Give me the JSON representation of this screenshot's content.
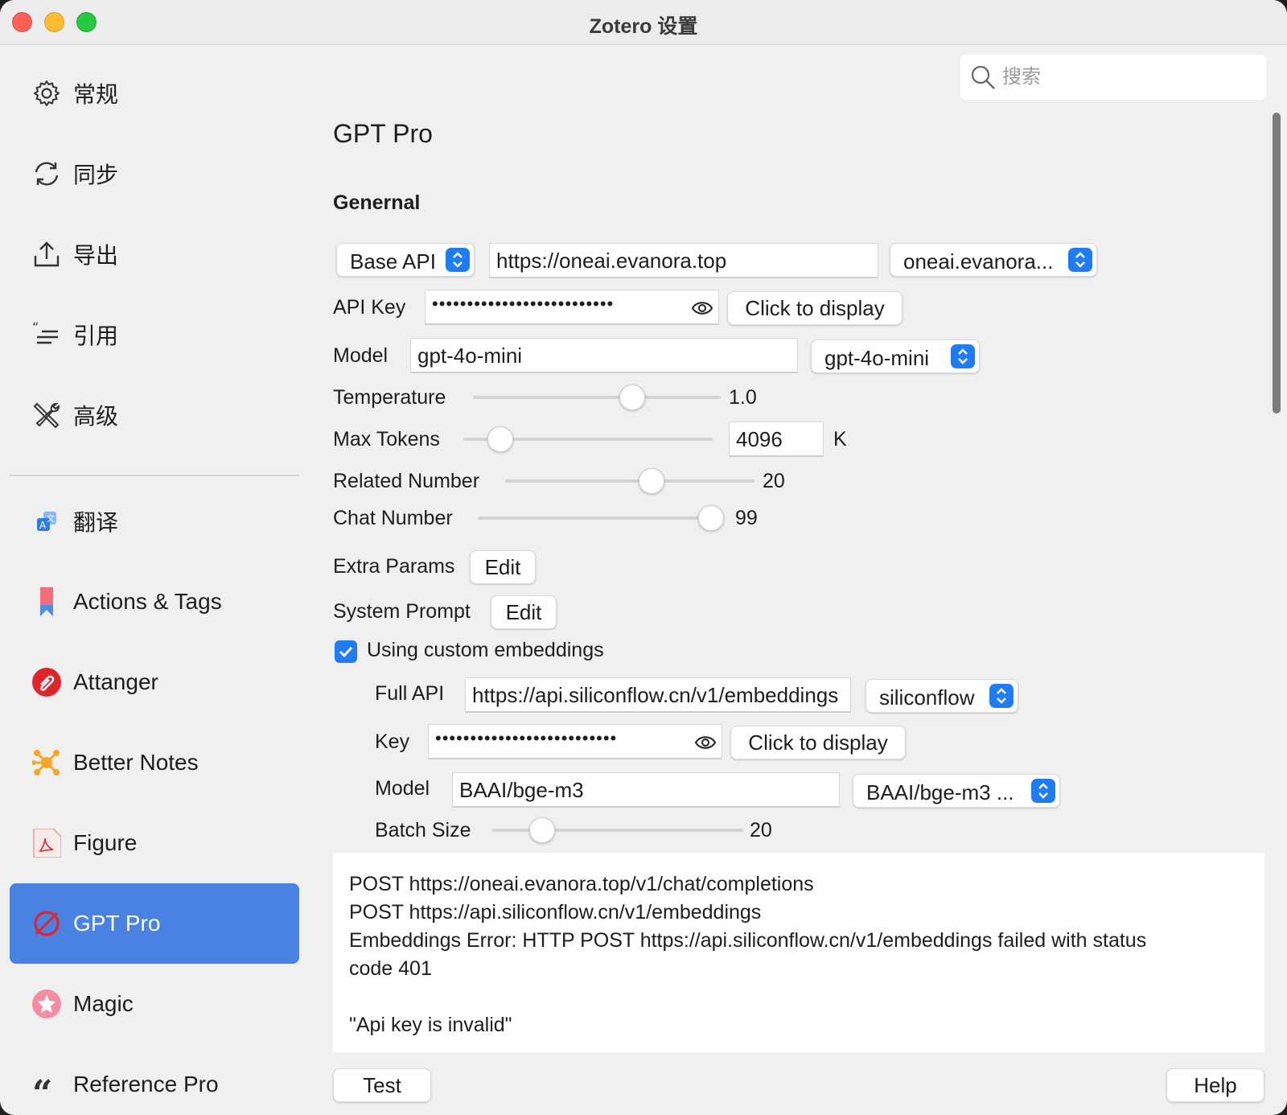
{
  "window": {
    "title": "Zotero 设置"
  },
  "sidebar": {
    "items": [
      {
        "label": "常规",
        "icon": "gear-icon"
      },
      {
        "label": "同步",
        "icon": "sync-icon"
      },
      {
        "label": "导出",
        "icon": "export-icon"
      },
      {
        "label": "引用",
        "icon": "cite-icon"
      },
      {
        "label": "高级",
        "icon": "tools-icon"
      },
      {
        "label": "翻译",
        "icon": "translate-icon"
      },
      {
        "label": "Actions & Tags",
        "icon": "bookmark-icon"
      },
      {
        "label": "Attanger",
        "icon": "attanger-icon"
      },
      {
        "label": "Better Notes",
        "icon": "better-notes-icon"
      },
      {
        "label": "Figure",
        "icon": "pdf-icon"
      },
      {
        "label": "GPT Pro",
        "icon": "gpt-pro-icon",
        "active": true
      },
      {
        "label": "Magic",
        "icon": "magic-icon"
      },
      {
        "label": "Reference Pro",
        "icon": "quote-icon"
      }
    ],
    "active_color": "#4a82e4"
  },
  "search": {
    "placeholder": "搜索"
  },
  "main": {
    "title": "GPT Pro",
    "section": "Genernal",
    "base_api": {
      "select": "Base API",
      "url": "https://oneai.evanora.top",
      "preset": "oneai.evanora..."
    },
    "api_key": {
      "label": "API Key",
      "masked": "••••••••••••••••••••••••••",
      "button": "Click to display"
    },
    "model": {
      "label": "Model",
      "value": "gpt-4o-mini",
      "preset": "gpt-4o-mini"
    },
    "temperature": {
      "label": "Temperature",
      "value": "1.0",
      "fraction": 0.63
    },
    "max_tokens": {
      "label": "Max Tokens",
      "value": "4096",
      "unit": "K",
      "fraction": 0.15
    },
    "related_number": {
      "label": "Related Number",
      "value": "20",
      "fraction": 0.58
    },
    "chat_number": {
      "label": "Chat Number",
      "value": "99",
      "fraction": 0.99
    },
    "extra_params": {
      "label": "Extra Params",
      "button": "Edit"
    },
    "system_prompt": {
      "label": "System Prompt",
      "button": "Edit"
    },
    "custom_embeddings": {
      "label": "Using custom embeddings",
      "checked": true
    },
    "full_api": {
      "label": "Full API",
      "url": "https://api.siliconflow.cn/v1/embeddings",
      "preset": "siliconflow"
    },
    "embed_key": {
      "label": "Key",
      "masked": "••••••••••••••••••••••••••",
      "button": "Click to display"
    },
    "embed_model": {
      "label": "Model",
      "value": "BAAI/bge-m3",
      "preset": "BAAI/bge-m3 ..."
    },
    "batch_size": {
      "label": "Batch Size",
      "value": "20",
      "fraction": 0.2
    },
    "log": [
      "POST https://oneai.evanora.top/v1/chat/completions",
      "POST https://api.siliconflow.cn/v1/embeddings",
      "Embeddings Error: HTTP POST https://api.siliconflow.cn/v1/embeddings failed with status",
      "code 401",
      "",
      "\"Api key is invalid\""
    ],
    "test_button": "Test",
    "help_button": "Help"
  },
  "colors": {
    "accent": "#1f7cf5"
  }
}
